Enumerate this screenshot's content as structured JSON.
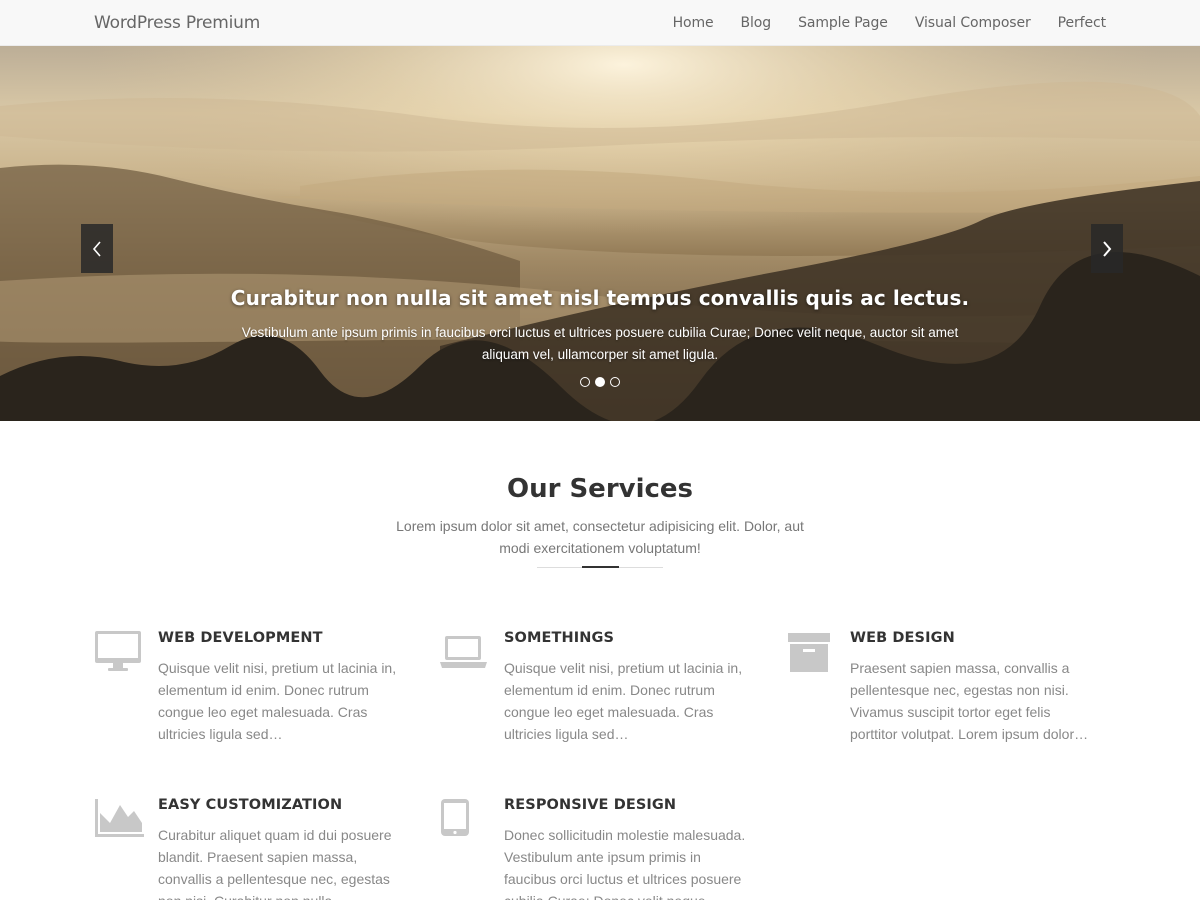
{
  "header": {
    "site_title": "WordPress Premium",
    "nav": [
      "Home",
      "Blog",
      "Sample Page",
      "Visual Composer",
      "Perfect"
    ]
  },
  "slider": {
    "title": "Curabitur non nulla sit amet nisl tempus convallis quis ac lectus.",
    "text": "Vestibulum ante ipsum primis in faucibus orci luctus et ultrices posuere cubilia Curae; Donec velit neque, auctor sit amet aliquam vel, ullamcorper sit amet ligula.",
    "dots_count": 3,
    "active_dot": 2,
    "prev_icon": "chevron-left-icon",
    "next_icon": "chevron-right-icon"
  },
  "services": {
    "heading": "Our Services",
    "intro": "Lorem ipsum dolor sit amet, consectetur adipisicing elit. Dolor, aut modi exercitationem voluptatum!",
    "items": [
      {
        "icon": "desktop-icon",
        "title": "WEB DEVELOPMENT",
        "text": "Quisque velit nisi, pretium ut lacinia in, elementum id enim. Donec rutrum congue leo eget malesuada. Cras ultricies ligula sed…"
      },
      {
        "icon": "laptop-icon",
        "title": "SOMETHINGS",
        "text": "Quisque velit nisi, pretium ut lacinia in, elementum id enim. Donec rutrum congue leo eget malesuada. Cras ultricies ligula sed…"
      },
      {
        "icon": "archive-icon",
        "title": "WEB DESIGN",
        "text": "Praesent sapien massa, convallis a pellentesque nec, egestas non nisi. Vivamus suscipit tortor eget felis porttitor volutpat. Lorem ipsum dolor…"
      },
      {
        "icon": "area-chart-icon",
        "title": "EASY CUSTOMIZATION",
        "text": "Curabitur aliquet quam id dui posuere blandit. Praesent sapien massa, convallis a pellentesque nec, egestas non nisi. Curabitur non nulla…"
      },
      {
        "icon": "tablet-icon",
        "title": "RESPONSIVE DESIGN",
        "text": "Donec sollicitudin molestie malesuada. Vestibulum ante ipsum primis in faucibus orci luctus et ultrices posuere cubilia Curae; Donec velit neque…"
      }
    ]
  },
  "colors": {
    "accent": "#333333",
    "icon": "#c8c8c8",
    "muted_text": "#888888"
  }
}
